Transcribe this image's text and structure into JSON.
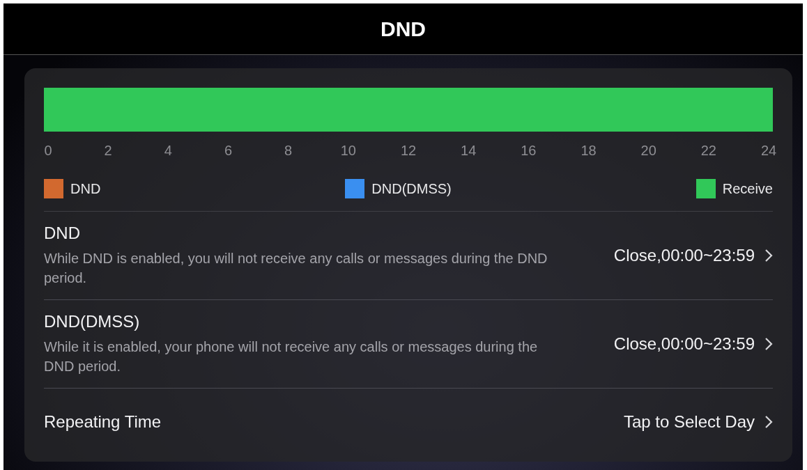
{
  "header": {
    "title": "DND"
  },
  "schedule": {
    "hour_labels": [
      "0",
      "2",
      "4",
      "6",
      "8",
      "10",
      "12",
      "14",
      "16",
      "18",
      "20",
      "22",
      "24"
    ],
    "legend": [
      {
        "kind": "dnd",
        "label": "DND",
        "color": "#d2692f"
      },
      {
        "kind": "dnd_dmss",
        "label": "DND(DMSS)",
        "color": "#3a8ff0"
      },
      {
        "kind": "receive",
        "label": "Receive",
        "color": "#31c859"
      }
    ],
    "bar_segments": [
      {
        "kind": "receive"
      }
    ]
  },
  "settings": [
    {
      "kind": "described",
      "title": "DND",
      "description": "While DND is enabled, you will not receive any calls or messages during the DND period.",
      "value": "Close,00:00~23:59"
    },
    {
      "kind": "described",
      "title": "DND(DMSS)",
      "description": "While it is enabled, your phone will not receive any calls or messages during the DND period.",
      "value": "Close,00:00~23:59"
    },
    {
      "kind": "plain",
      "title": "Repeating Time",
      "value": "Tap to Select Day"
    }
  ]
}
